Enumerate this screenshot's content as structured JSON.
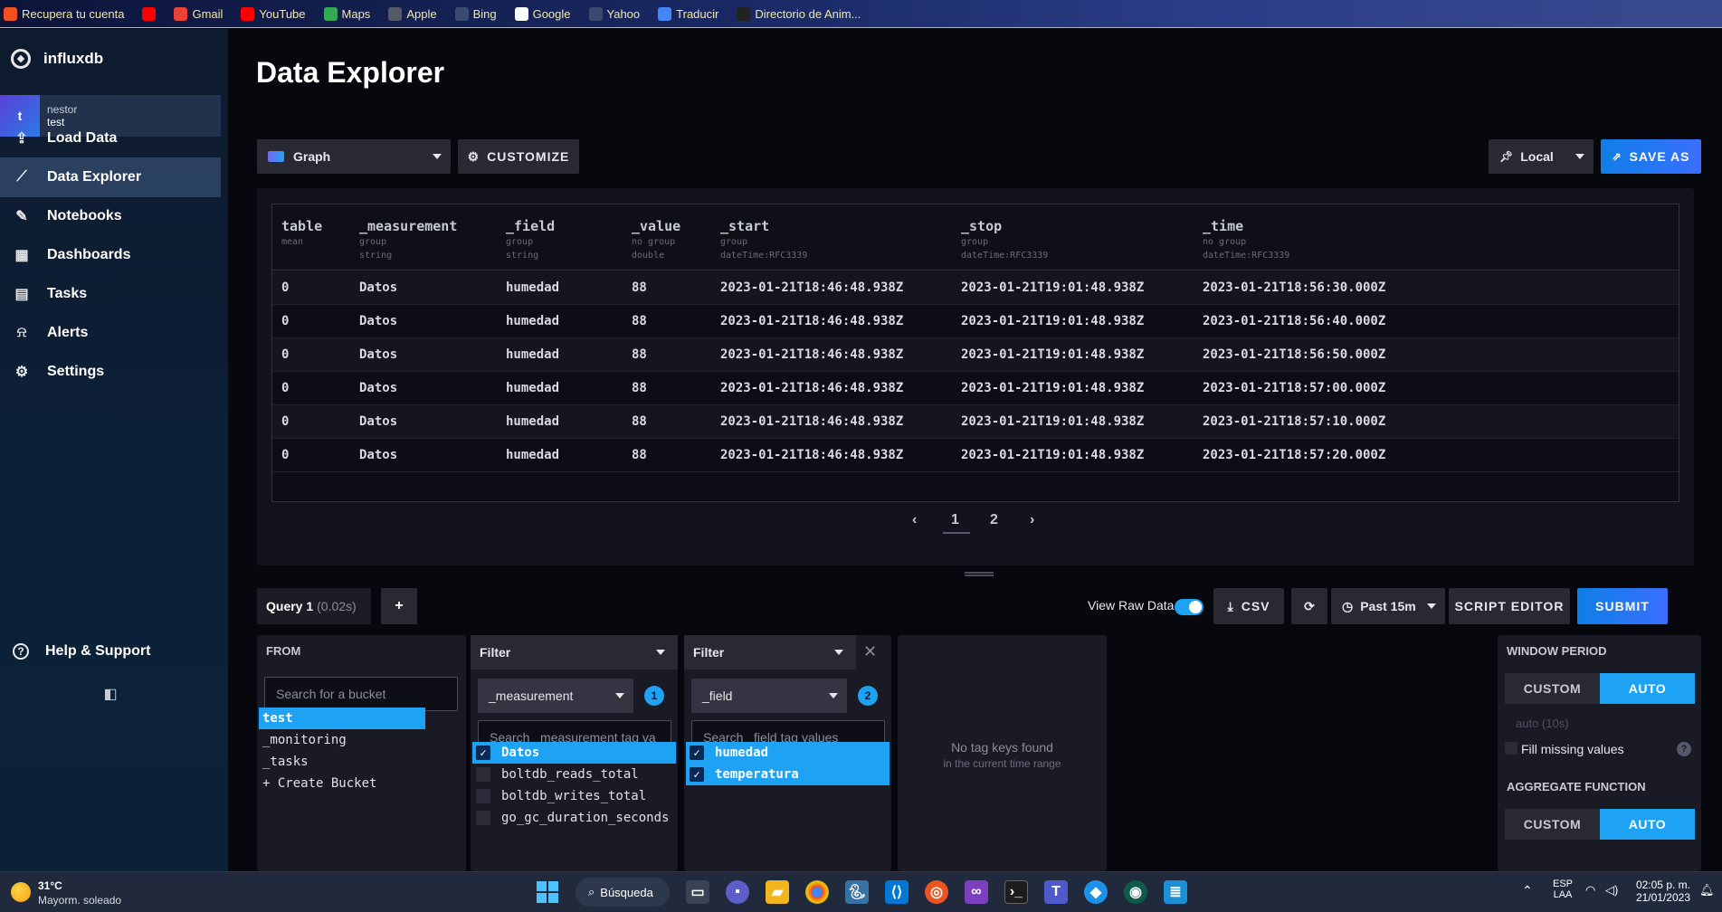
{
  "bookmarks": [
    {
      "label": "Recupera tu cuenta",
      "icon": "windows-icon",
      "color": "#f25022"
    },
    {
      "label": "",
      "icon": "youtube-icon",
      "color": "#ff0000"
    },
    {
      "label": "Gmail",
      "icon": "gmail-icon",
      "color": "#ea4335"
    },
    {
      "label": "YouTube",
      "icon": "youtube-icon",
      "color": "#ff0000"
    },
    {
      "label": "Maps",
      "icon": "maps-icon",
      "color": "#34a853"
    },
    {
      "label": "Apple",
      "icon": "apple-icon",
      "color": "#555b66"
    },
    {
      "label": "Bing",
      "icon": "bing-icon",
      "color": "#3c4a70"
    },
    {
      "label": "Google",
      "icon": "google-icon",
      "color": "#ffffff"
    },
    {
      "label": "Yahoo",
      "icon": "yahoo-icon",
      "color": "#3c4a70"
    },
    {
      "label": "Traducir",
      "icon": "translate-icon",
      "color": "#4285f4"
    },
    {
      "label": "Directorio de Anim...",
      "icon": "af-icon",
      "color": "#222222"
    }
  ],
  "sidebar": {
    "brand": "influxdb",
    "org": {
      "initial": "t",
      "user": "nestor",
      "org": "test"
    },
    "items": [
      {
        "label": "Load Data",
        "icon": "upload-icon",
        "glyph": "⇪"
      },
      {
        "label": "Data Explorer",
        "icon": "graph-icon",
        "glyph": "⟋"
      },
      {
        "label": "Notebooks",
        "icon": "pencil-icon",
        "glyph": "✎"
      },
      {
        "label": "Dashboards",
        "icon": "dashboard-icon",
        "glyph": "▦"
      },
      {
        "label": "Tasks",
        "icon": "calendar-icon",
        "glyph": "▤"
      },
      {
        "label": "Alerts",
        "icon": "bell-icon",
        "glyph": "⍾"
      },
      {
        "label": "Settings",
        "icon": "gear-icon",
        "glyph": "⚙"
      }
    ],
    "help": "Help & Support",
    "help_glyph": "?",
    "collapse_glyph": "◧"
  },
  "header": {
    "title": "Data Explorer"
  },
  "toolbar": {
    "graph_type": "Graph",
    "customize": "CUSTOMIZE",
    "timezone": "Local",
    "save_as": "SAVE AS"
  },
  "table": {
    "columns": [
      {
        "name": "table",
        "group": "mean",
        "type": ""
      },
      {
        "name": "_measurement",
        "group": "group",
        "type": "string"
      },
      {
        "name": "_field",
        "group": "group",
        "type": "string"
      },
      {
        "name": "_value",
        "group": "no group",
        "type": "double"
      },
      {
        "name": "_start",
        "group": "group",
        "type": "dateTime:RFC3339"
      },
      {
        "name": "_stop",
        "group": "group",
        "type": "dateTime:RFC3339"
      },
      {
        "name": "_time",
        "group": "no group",
        "type": "dateTime:RFC3339"
      }
    ],
    "rows": [
      [
        "0",
        "Datos",
        "humedad",
        "88",
        "2023-01-21T18:46:48.938Z",
        "2023-01-21T19:01:48.938Z",
        "2023-01-21T18:56:30.000Z"
      ],
      [
        "0",
        "Datos",
        "humedad",
        "88",
        "2023-01-21T18:46:48.938Z",
        "2023-01-21T19:01:48.938Z",
        "2023-01-21T18:56:40.000Z"
      ],
      [
        "0",
        "Datos",
        "humedad",
        "88",
        "2023-01-21T18:46:48.938Z",
        "2023-01-21T19:01:48.938Z",
        "2023-01-21T18:56:50.000Z"
      ],
      [
        "0",
        "Datos",
        "humedad",
        "88",
        "2023-01-21T18:46:48.938Z",
        "2023-01-21T19:01:48.938Z",
        "2023-01-21T18:57:00.000Z"
      ],
      [
        "0",
        "Datos",
        "humedad",
        "88",
        "2023-01-21T18:46:48.938Z",
        "2023-01-21T19:01:48.938Z",
        "2023-01-21T18:57:10.000Z"
      ],
      [
        "0",
        "Datos",
        "humedad",
        "88",
        "2023-01-21T18:46:48.938Z",
        "2023-01-21T19:01:48.938Z",
        "2023-01-21T18:57:20.000Z"
      ]
    ],
    "pages": [
      "1",
      "2"
    ],
    "current_page": "1"
  },
  "query": {
    "tab_label": "Query 1",
    "tab_time": "(0.02s)",
    "add": "+",
    "view_raw": "View Raw Data",
    "csv": "CSV",
    "time_range": "Past 15m",
    "script_editor": "SCRIPT EDITOR",
    "submit": "SUBMIT"
  },
  "from": {
    "title": "FROM",
    "search_placeholder": "Search for a bucket",
    "buckets": [
      {
        "label": "test",
        "selected": true
      },
      {
        "label": "_monitoring",
        "selected": false
      },
      {
        "label": "_tasks",
        "selected": false
      },
      {
        "label": "+ Create Bucket",
        "selected": false
      }
    ]
  },
  "filter1": {
    "title": "Filter",
    "key": "_measurement",
    "count": "1",
    "search_placeholder": "Search _measurement tag va",
    "values": [
      {
        "label": "Datos",
        "checked": true
      },
      {
        "label": "boltdb_reads_total",
        "checked": false
      },
      {
        "label": "boltdb_writes_total",
        "checked": false
      },
      {
        "label": "go_gc_duration_seconds",
        "checked": false
      }
    ]
  },
  "filter2": {
    "title": "Filter",
    "key": "_field",
    "count": "2",
    "search_placeholder": "Search _field tag values",
    "values": [
      {
        "label": "humedad",
        "checked": true
      },
      {
        "label": "temperatura",
        "checked": true
      }
    ]
  },
  "empty": {
    "line1": "No tag keys found",
    "line2": "in the current time range"
  },
  "window": {
    "title": "WINDOW PERIOD",
    "custom": "CUSTOM",
    "auto": "AUTO",
    "auto_value": "auto (10s)",
    "fill_missing": "Fill missing values",
    "agg_title": "AGGREGATE FUNCTION"
  },
  "taskbar": {
    "weather_temp": "31°C",
    "weather_desc": "Mayorm. soleado",
    "search": "Búsqueda",
    "lang1": "ESP",
    "lang2": "LAA",
    "time": "02:05 p. m.",
    "date": "21/01/2023"
  },
  "colors": {
    "accent": "#1ea2f3",
    "submit": "#2e7cf6",
    "bg": "#07070e",
    "panel": "#13131d"
  }
}
